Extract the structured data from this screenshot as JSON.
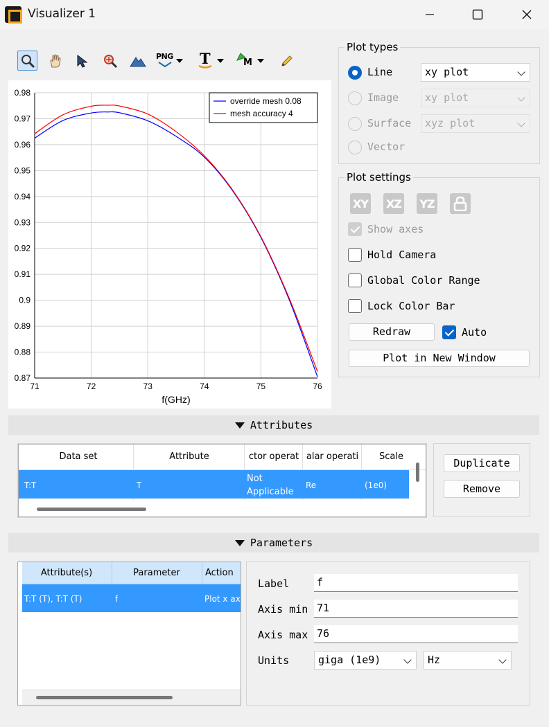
{
  "window": {
    "title": "Visualizer 1"
  },
  "toolbar": {
    "png_label": "PNG",
    "text_label": "T",
    "mesh_label": "M"
  },
  "chart_data": {
    "type": "line",
    "title": "",
    "xlabel": "f(GHz)",
    "ylabel": "",
    "xlim": [
      71,
      76
    ],
    "ylim": [
      0.87,
      0.98
    ],
    "xticks": [
      "71",
      "72",
      "73",
      "74",
      "75",
      "76"
    ],
    "yticks": [
      "0.98",
      "0.97",
      "0.96",
      "0.95",
      "0.94",
      "0.93",
      "0.92",
      "0.91",
      "0.9",
      "0.89",
      "0.88",
      "0.87"
    ],
    "grid": true,
    "legend": "top-right",
    "series": [
      {
        "name": "override mesh 0.08",
        "color": "#0000ff",
        "x": [
          71,
          71.5,
          72,
          72.3,
          72.5,
          73,
          73.5,
          74,
          74.5,
          75,
          75.5,
          76
        ],
        "y": [
          0.9625,
          0.9693,
          0.9722,
          0.9726,
          0.9723,
          0.9692,
          0.9632,
          0.9552,
          0.9422,
          0.9242,
          0.9002,
          0.8705
        ]
      },
      {
        "name": "mesh accuracy 4",
        "color": "#ff0000",
        "x": [
          71,
          71.5,
          72,
          72.3,
          72.5,
          73,
          73.5,
          74,
          74.5,
          75,
          75.5,
          76
        ],
        "y": [
          0.9642,
          0.9715,
          0.9748,
          0.9752,
          0.9749,
          0.9718,
          0.965,
          0.9557,
          0.9425,
          0.9245,
          0.9008,
          0.8725
        ]
      }
    ]
  },
  "plot_types": {
    "title": "Plot types",
    "options": [
      {
        "label": "Line",
        "combo": "xy plot"
      },
      {
        "label": "Image",
        "combo": "xy plot"
      },
      {
        "label": "Surface",
        "combo": "xyz plot"
      },
      {
        "label": "Vector"
      }
    ]
  },
  "plot_settings": {
    "title": "Plot settings",
    "view_buttons": [
      "XY",
      "XZ",
      "YZ"
    ],
    "show_axes": "Show axes",
    "hold_camera": "Hold Camera",
    "global_color_range": "Global Color Range",
    "lock_color_bar": "Lock Color Bar",
    "redraw": "Redraw",
    "auto": "Auto",
    "plot_new_window": "Plot in New Window"
  },
  "attributes": {
    "title": "Attributes",
    "columns": [
      "Data set",
      "Attribute",
      "ctor operat",
      "alar operati",
      "Scale"
    ],
    "row": [
      "T:T",
      "T",
      "Not Applicable",
      "Re",
      "(1e0)"
    ],
    "duplicate": "Duplicate",
    "remove": "Remove"
  },
  "parameters": {
    "title": "Parameters",
    "columns": [
      "Attribute(s)",
      "Parameter",
      "Action"
    ],
    "row": [
      "T:T (T), T:T (T)",
      "f",
      "Plot x ax"
    ],
    "label_label": "Label",
    "label_value": "f",
    "axis_min_label": "Axis min",
    "axis_min_value": "71",
    "axis_max_label": "Axis max",
    "axis_max_value": "76",
    "units_label": "Units",
    "units_scale": "giga (1e9)",
    "units_unit": "Hz"
  }
}
